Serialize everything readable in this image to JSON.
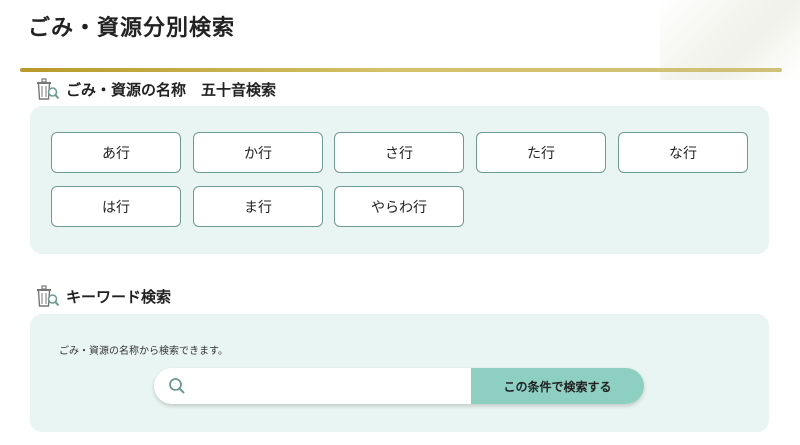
{
  "page_title": "ごみ・資源分別検索",
  "sections": {
    "kana": {
      "title": "ごみ・資源の名称　五十音検索",
      "icon": "trash-search-icon",
      "buttons": [
        "あ行",
        "か行",
        "さ行",
        "た行",
        "な行",
        "は行",
        "ま行",
        "やらわ行"
      ]
    },
    "keyword": {
      "title": "キーワード検索",
      "icon": "trash-search-icon",
      "description": "ごみ・資源の名称から検索できます。",
      "search": {
        "placeholder": "",
        "value": "",
        "icon": "search-icon"
      },
      "submit_label": "この条件で検索する"
    }
  },
  "colors": {
    "accent_gold": "#c4ab3a",
    "panel_bg": "#e9f5f2",
    "button_border": "#6f9a93",
    "submit_bg": "#8dd0c2"
  }
}
